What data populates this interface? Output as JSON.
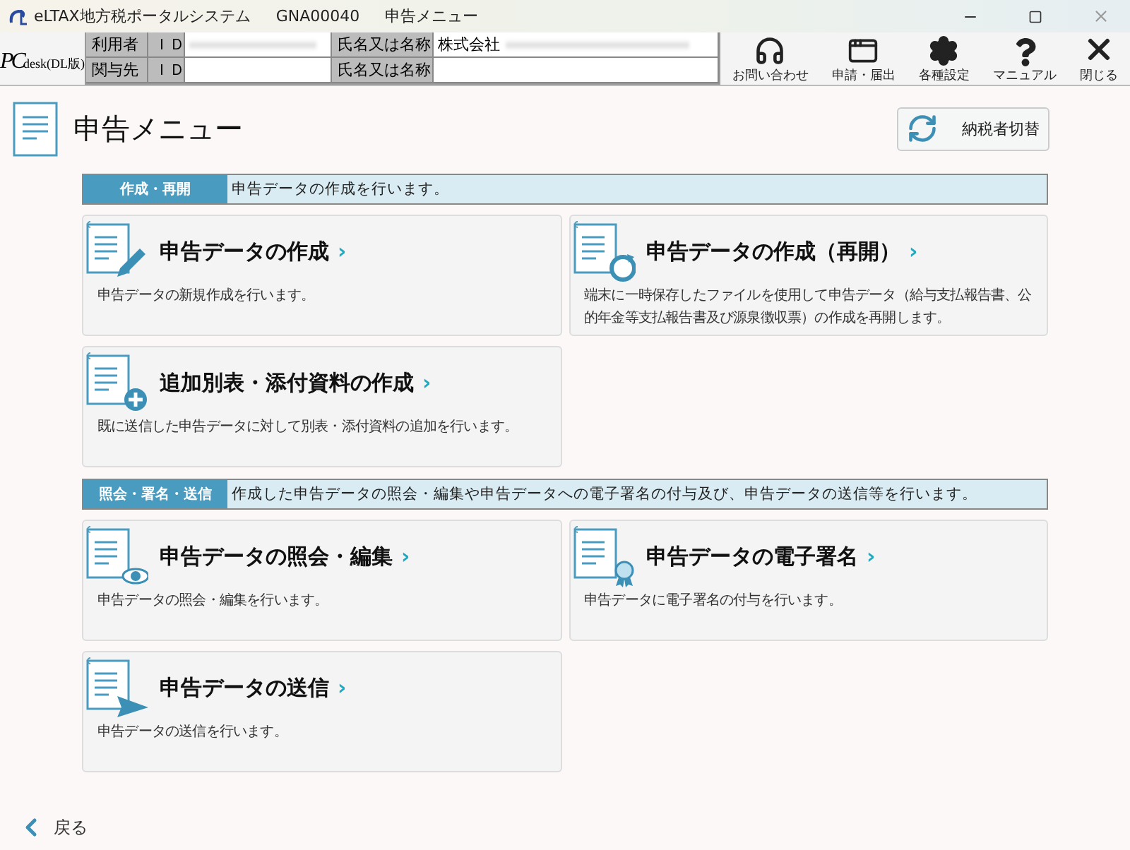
{
  "window": {
    "app_name": "eLTAX地方税ポータルシステム",
    "screen_id": "GNA00040",
    "screen_name": "申告メニュー"
  },
  "logo": {
    "brand": "PC",
    "suffix": "desk",
    "edition": "(DL版)"
  },
  "info_rows": [
    {
      "label": "利用者",
      "id_label": "ＩＤ",
      "name_label": "氏名又は名称",
      "name_value": "株式会社",
      "redacted": true
    },
    {
      "label": "関与先",
      "id_label": "ＩＤ",
      "name_label": "氏名又は名称",
      "redacted": false
    }
  ],
  "toolbar": [
    {
      "kind": "headset",
      "label": "お問い合わせ"
    },
    {
      "kind": "window",
      "label": "申請・届出"
    },
    {
      "kind": "gear",
      "label": "各種設定"
    },
    {
      "kind": "question",
      "label": "マニュアル"
    },
    {
      "kind": "close",
      "label": "閉じる"
    }
  ],
  "page_title": "申告メニュー",
  "switch_button": "納税者切替",
  "sections": [
    {
      "tag": "作成・再開",
      "description": "申告データの作成を行います。",
      "cards": [
        {
          "kind": "pencil",
          "title": "申告データの作成",
          "arrow": "›",
          "text": "申告データの新規作成を行います。"
        },
        {
          "kind": "refresh",
          "title": "申告データの作成（再開）",
          "arrow": "›",
          "text": "端末に一時保存したファイルを使用して申告データ（給与支払報告書、公的年金等支払報告書及び源泉徴収票）の作成を再開します。"
        },
        {
          "kind": "plus",
          "title": "追加別表・添付資料の作成",
          "arrow": "›",
          "text": "既に送信した申告データに対して別表・添付資料の追加を行います。"
        }
      ]
    },
    {
      "tag": "照会・署名・送信",
      "description": "作成した申告データの照会・編集や申告データへの電子署名の付与及び、申告データの送信等を行います。",
      "cards": [
        {
          "kind": "eye",
          "title": "申告データの照会・編集",
          "arrow": "›",
          "text": "申告データの照会・編集を行います。"
        },
        {
          "kind": "seal",
          "title": "申告データの電子署名",
          "arrow": "›",
          "text": "申告データに電子署名の付与を行います。"
        },
        {
          "kind": "send",
          "title": "申告データの送信",
          "arrow": "›",
          "text": "申告データの送信を行います。"
        }
      ]
    }
  ],
  "back_link": "戻る"
}
